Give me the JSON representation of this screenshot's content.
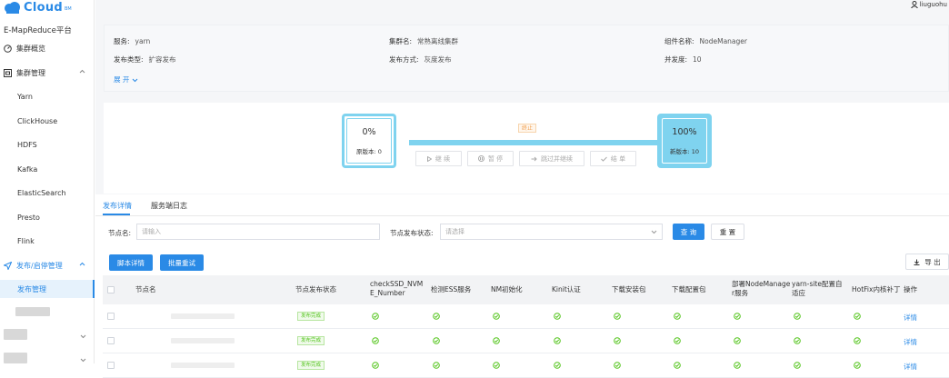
{
  "brand": {
    "logo_text": "Cloud",
    "logo_sub": "BM",
    "product": "E-MapReduce平台"
  },
  "user": {
    "name": "liuguohu"
  },
  "sidebar": {
    "items": [
      {
        "label": "集群概览",
        "icon": "dashboard-icon"
      },
      {
        "label": "集群管理",
        "icon": "cluster-icon"
      },
      {
        "label": "Yarn"
      },
      {
        "label": "ClickHouse"
      },
      {
        "label": "HDFS"
      },
      {
        "label": "Kafka"
      },
      {
        "label": "ElasticSearch"
      },
      {
        "label": "Presto"
      },
      {
        "label": "Flink"
      },
      {
        "label": "发布/启停管理",
        "icon": "send-icon"
      },
      {
        "label": "发布管理"
      }
    ]
  },
  "info": {
    "service_k": "服务:",
    "service_v": "yarn",
    "cluster_k": "集群名:",
    "cluster_v": "常熟离线集群",
    "component_k": "组件名称:",
    "component_v": "NodeManager",
    "type_k": "发布类型:",
    "type_v": "扩容发布",
    "method_k": "发布方式:",
    "method_v": "灰度发布",
    "concurrency_k": "并发度:",
    "concurrency_v": "10",
    "expand": "展 开"
  },
  "flow": {
    "left_pct": "0%",
    "left_label": "原版本: 0",
    "right_pct": "100%",
    "right_label": "新版本: 10",
    "status_badge": "终止",
    "buttons": {
      "continue": "继 续",
      "pause": "暂 停",
      "skip": "跳过并继续",
      "finish": "结 单"
    }
  },
  "tabs": {
    "detail": "发布详情",
    "log": "服务端日志"
  },
  "filters": {
    "node_label": "节点名:",
    "node_placeholder": "请输入",
    "status_label": "节点发布状态:",
    "status_placeholder": "请选择",
    "query": "查 询",
    "reset": "重 置"
  },
  "actions": {
    "script_detail": "脚本详情",
    "batch_retry": "批量重试",
    "export": "导 出"
  },
  "table": {
    "headers": {
      "node": "节点名",
      "status": "节点发布状态",
      "check_line1": "checkSSD_NVM",
      "check_line2": "E_Number",
      "ess": "检测ESS服务",
      "nm_init": "NM初始化",
      "kinit": "Kinit认证",
      "download_pkg": "下载安装包",
      "download_cfg": "下载配置包",
      "deploy_line1": "部署NodeManage",
      "deploy_line2": "r服务",
      "yarn_line1": "yarn-site配置自",
      "yarn_line2": "适应",
      "hotfix": "HotFix内核补丁",
      "op": "操作"
    },
    "rows": [
      {
        "status": "发布完成",
        "op": "详情"
      },
      {
        "status": "发布完成",
        "op": "详情"
      },
      {
        "status": "发布完成",
        "op": "详情"
      }
    ]
  },
  "colors": {
    "accent": "#2a8ae6",
    "progress": "#7fd3ef",
    "success": "#52c41a",
    "warn": "#f0a050"
  }
}
